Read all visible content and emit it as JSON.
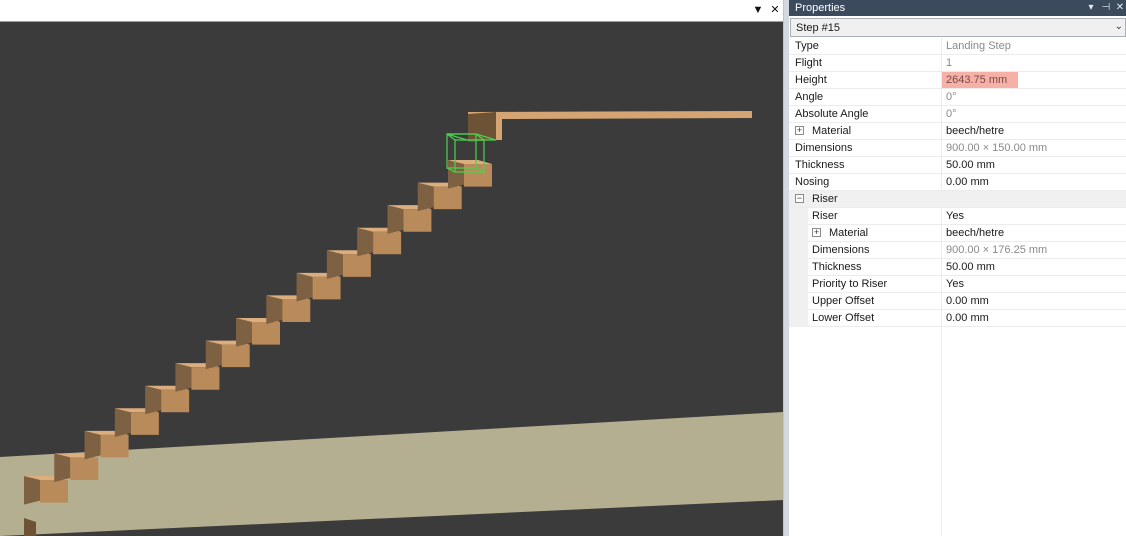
{
  "viewport": {
    "pin_icon": "dropdown-triangle-icon",
    "pin_glyph": "▼",
    "close_glyph": "✕",
    "colors": {
      "background": "#3b3b3b",
      "floor": "#b5af92",
      "wood_top": "#dcae7d",
      "wood_side": "#8a6a48",
      "selection": "#4cd14c"
    }
  },
  "properties": {
    "title": "Properties",
    "title_buttons": {
      "dropdown": "▾",
      "pin": "⊣",
      "close": "✕"
    },
    "selector": {
      "value": "Step #15",
      "arrow": "⌄"
    },
    "rows": [
      {
        "name": "Type",
        "value": "Landing Step",
        "readonly": true
      },
      {
        "name": "Flight",
        "value": "1",
        "readonly": true
      },
      {
        "name": "Height",
        "value": "2643.75 mm",
        "highlight": true
      },
      {
        "name": "Angle",
        "value": "0°",
        "readonly": true
      },
      {
        "name": "Absolute Angle",
        "value": "0°",
        "readonly": true
      },
      {
        "name": "Material",
        "value": "beech/hetre",
        "expander": "+"
      },
      {
        "name": "Dimensions",
        "value": "900.00 × 150.00 mm",
        "readonly": true
      },
      {
        "name": "Thickness",
        "value": "50.00 mm"
      },
      {
        "name": "Nosing",
        "value": "0.00 mm"
      },
      {
        "name": "Riser",
        "category": true,
        "expander": "−"
      },
      {
        "name": "Riser",
        "value": "Yes",
        "indent": true
      },
      {
        "name": "Material",
        "value": "beech/hetre",
        "indent": true,
        "expander": "+"
      },
      {
        "name": "Dimensions",
        "value": "900.00 × 176.25 mm",
        "indent": true,
        "readonly": true
      },
      {
        "name": "Thickness",
        "value": "50.00 mm",
        "indent": true
      },
      {
        "name": "Priority to Riser",
        "value": "Yes",
        "indent": true
      },
      {
        "name": "Upper Offset",
        "value": "0.00 mm",
        "indent": true
      },
      {
        "name": "Lower Offset",
        "value": "0.00 mm",
        "indent": true
      }
    ]
  }
}
